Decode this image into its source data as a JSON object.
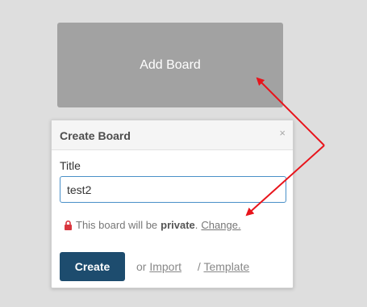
{
  "add_board": {
    "label": "Add Board"
  },
  "create_board_popup": {
    "title": "Create Board",
    "close_icon": "×",
    "title_field_label": "Title",
    "title_value": "test2",
    "privacy_prefix": "This board will be",
    "privacy_level": "private",
    "privacy_suffix": ".",
    "change_link": "Change.",
    "create_button": "Create",
    "or_text": "or",
    "import_link": "Import",
    "slash_text": "/",
    "template_link": "Template"
  },
  "colors": {
    "add_board_bg": "#a2a2a2",
    "create_button_bg": "#1d4c6e",
    "lock_icon": "#d9363e",
    "annotation_arrow": "#e8141b",
    "input_border": "#4a90c8"
  },
  "icons": {
    "lock": "lock-icon",
    "close": "close-icon"
  }
}
